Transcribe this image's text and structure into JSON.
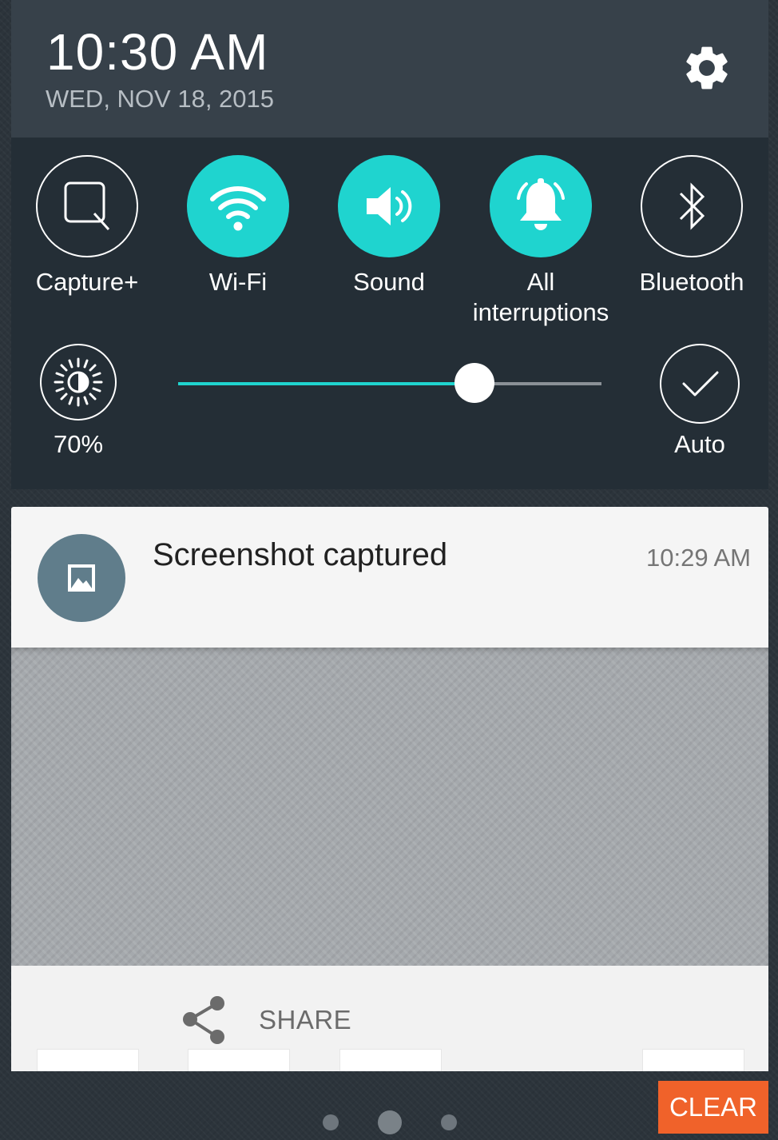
{
  "header": {
    "time": "10:30 AM",
    "date": "WED, NOV 18, 2015",
    "settings_icon": "gear-icon"
  },
  "quick_settings": {
    "tiles": [
      {
        "label": "Capture+",
        "icon": "capture-plus-icon",
        "active": false
      },
      {
        "label": "Wi-Fi",
        "icon": "wifi-icon",
        "active": true
      },
      {
        "label": "Sound",
        "icon": "speaker-icon",
        "active": true
      },
      {
        "label": "All interruptions",
        "icon": "bell-icon",
        "active": true
      },
      {
        "label": "Bluetooth",
        "icon": "bluetooth-icon",
        "active": false
      }
    ],
    "brightness": {
      "label": "70%",
      "level": 0.7,
      "auto_label": "Auto"
    }
  },
  "notification": {
    "title": "Screenshot captured",
    "time": "10:29 AM",
    "icon": "image-icon",
    "action": {
      "label": "SHARE",
      "icon": "share-icon"
    }
  },
  "footer": {
    "clear_label": "CLEAR",
    "page_count": 3,
    "current_page": 2
  },
  "colors": {
    "accent": "#1fd4cf",
    "clear_button": "#f0622a",
    "notification_avatar": "#607d8b"
  }
}
